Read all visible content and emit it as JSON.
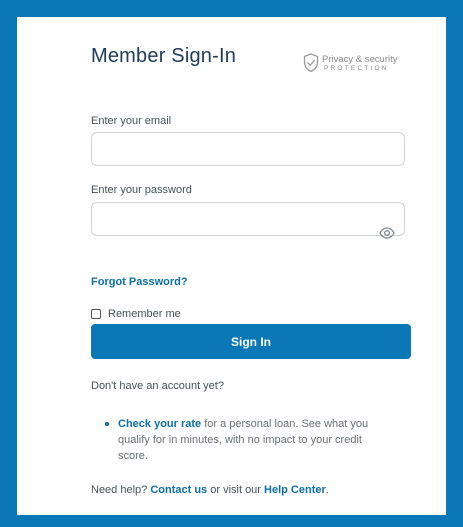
{
  "header": {
    "title": "Member Sign-In",
    "badge_line1": "Privacy & security",
    "badge_line2": "PROTECTION"
  },
  "form": {
    "email_label": "Enter your email",
    "email_value": "",
    "password_label": "Enter your password",
    "password_value": "",
    "forgot_link": "Forgot Password?",
    "remember_label": "Remember me",
    "remember_checked": false,
    "submit_label": "Sign In"
  },
  "signup": {
    "prompt": "Don't have an account yet?",
    "rate_link": "Check your rate",
    "rate_text": " for a personal loan. See what you qualify for in minutes, with no impact to your credit score."
  },
  "help": {
    "prefix": "Need help? ",
    "contact_link": "Contact us",
    "middle": " or visit our ",
    "help_center_link": "Help Center",
    "suffix": "."
  },
  "colors": {
    "background": "#0a77b6",
    "accent": "#0b6fa9",
    "title": "#1f3a5a"
  },
  "icons": {
    "badge": "shield-check-icon",
    "password_toggle": "eye-icon"
  }
}
